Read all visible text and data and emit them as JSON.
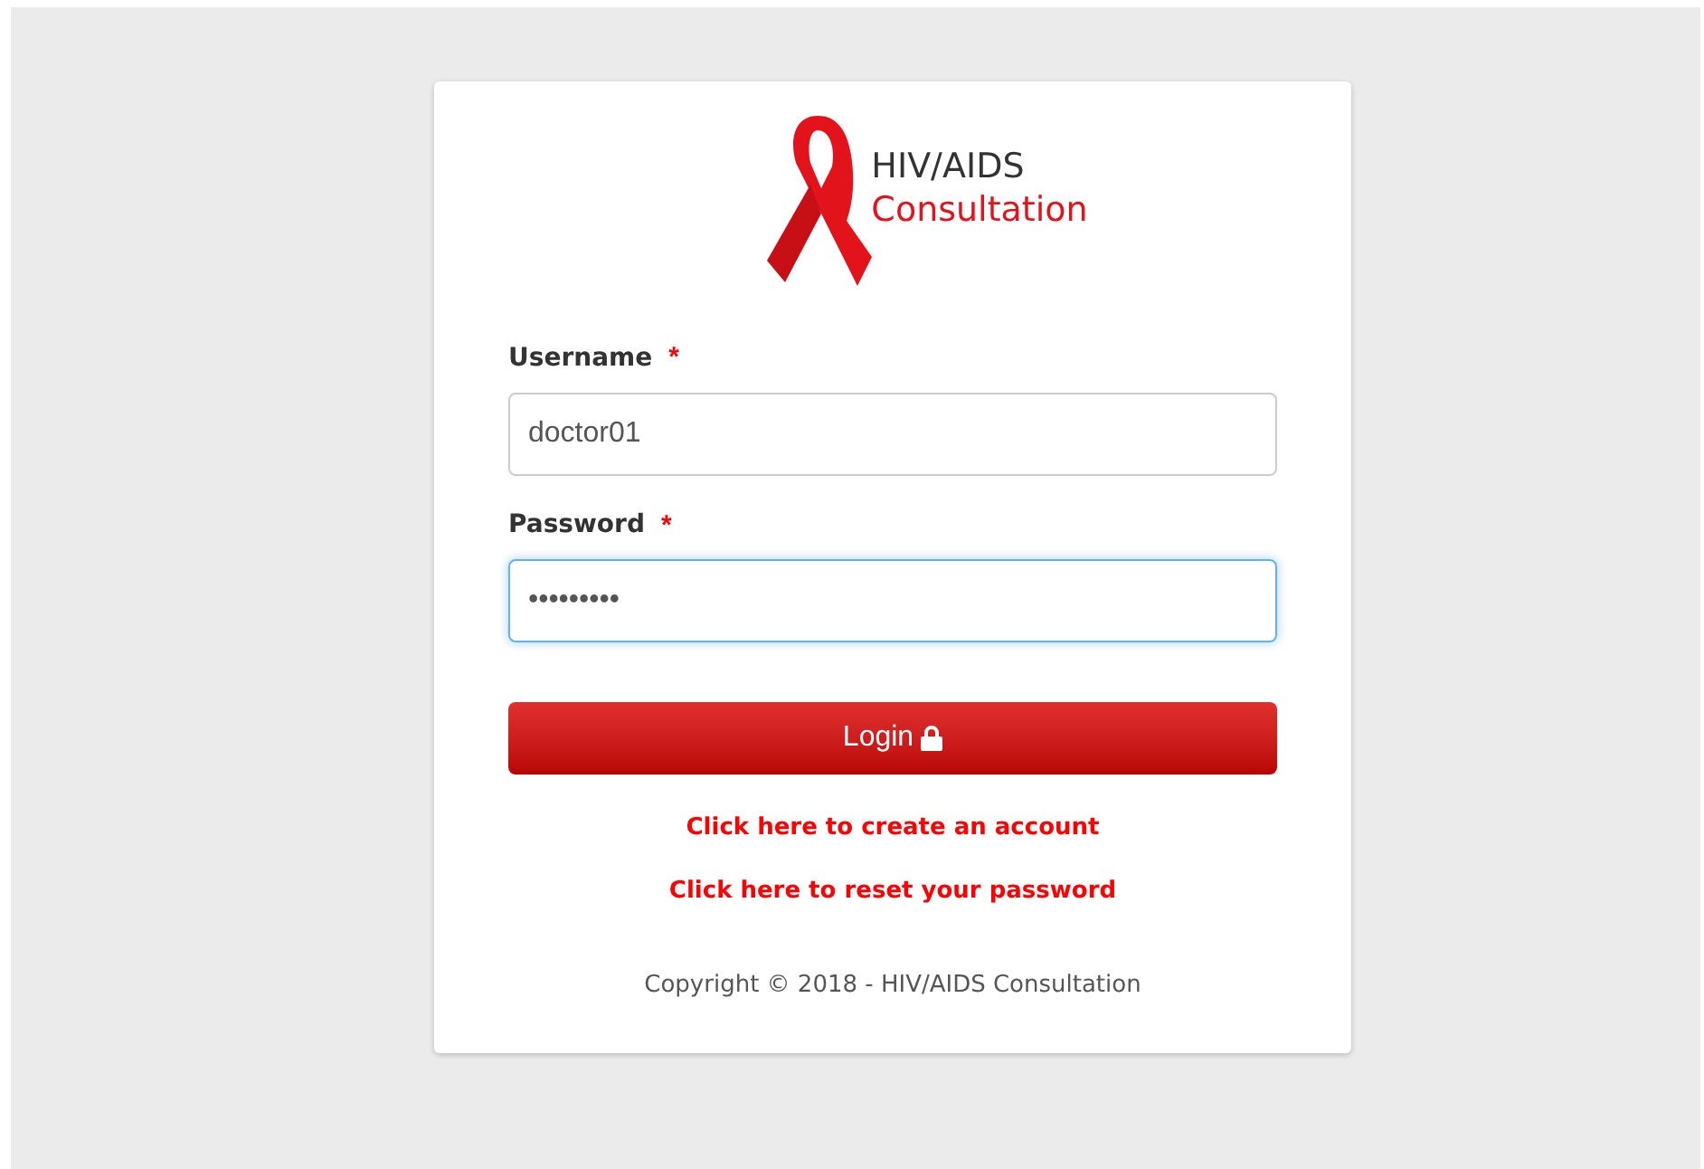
{
  "logo": {
    "line_1": "HIV/AIDS",
    "line_2": "Consultation"
  },
  "fields": [
    {
      "label": "Username",
      "required_mark": "*",
      "value": "doctor01",
      "focused": false
    },
    {
      "label": "Password",
      "required_mark": "*",
      "value": "•••••••••",
      "focused": true
    }
  ],
  "login_button": {
    "label": "Login"
  },
  "links": [
    "Click here to create an account",
    "Click here to reset your password"
  ],
  "copyright": "Copyright © 2018 - HIV/AIDS Consultation"
}
